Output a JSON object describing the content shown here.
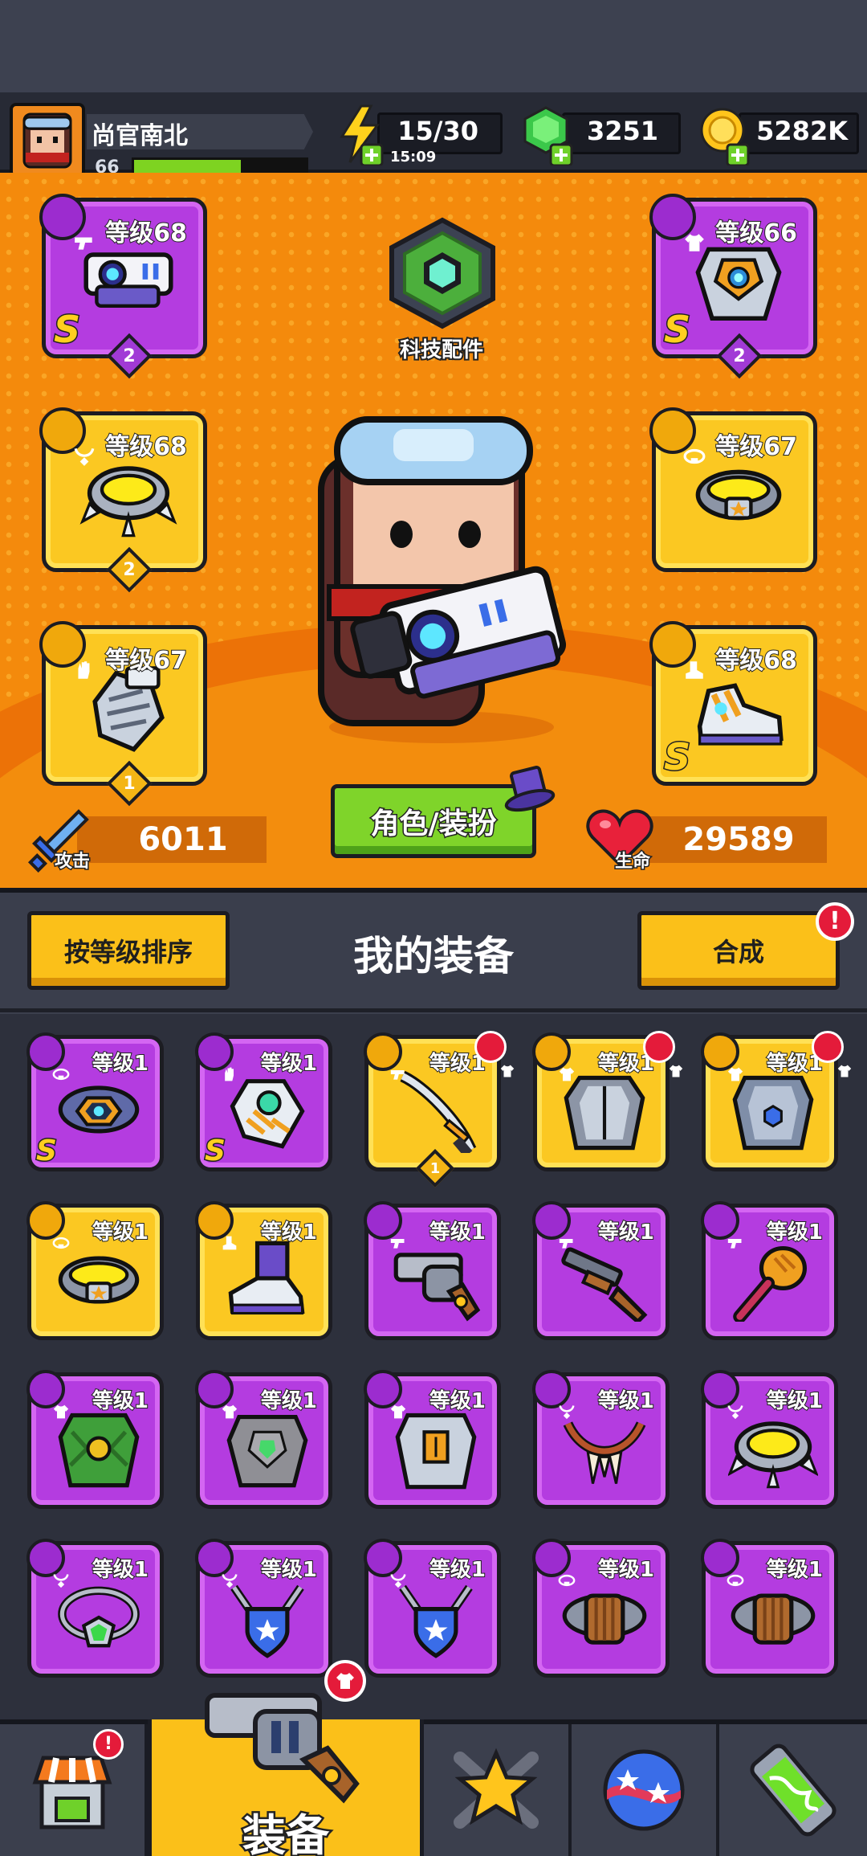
{
  "player": {
    "name": "尚官南北",
    "level": "66",
    "xp_fraction": 0.62
  },
  "resources": {
    "energy": "15/30",
    "energy_timer": "15:09",
    "gems": "3251",
    "coins": "5282K"
  },
  "equipped": {
    "slots": [
      {
        "slot": "weapon",
        "level_label": "等级68",
        "rarity": "purple",
        "rank": "S",
        "stars": "2",
        "icon": "laser-gun-icon",
        "badge_icon": "gun-icon"
      },
      {
        "slot": "armor",
        "level_label": "等级66",
        "rarity": "purple",
        "rank": "S",
        "stars": "2",
        "icon": "mech-armor-icon",
        "badge_icon": "shirt-icon"
      },
      {
        "slot": "necklace",
        "level_label": "等级68",
        "rarity": "gold",
        "rank": "",
        "stars": "2",
        "icon": "spiked-collar-icon",
        "badge_icon": "necklace-icon"
      },
      {
        "slot": "belt",
        "level_label": "等级67",
        "rarity": "gold",
        "rank": "",
        "stars": "",
        "icon": "star-belt-icon",
        "badge_icon": "belt-icon"
      },
      {
        "slot": "gloves",
        "level_label": "等级67",
        "rarity": "gold",
        "rank": "",
        "stars": "1",
        "icon": "gauntlet-icon",
        "badge_icon": "glove-icon"
      },
      {
        "slot": "boots",
        "level_label": "等级68",
        "rarity": "gold",
        "rank": "S",
        "stars": "",
        "icon": "sneaker-icon",
        "badge_icon": "boot-icon"
      }
    ],
    "tech_label": "科技配件",
    "attack_label": "攻击",
    "attack_value": "6011",
    "hp_label": "生命",
    "hp_value": "29589",
    "costume_button": "角色/装扮"
  },
  "gear_section": {
    "sort_button": "按等级排序",
    "title": "我的装备",
    "merge_button": "合成",
    "merge_alert": "!"
  },
  "inventory": [
    {
      "level_label": "等级1",
      "rarity": "purple",
      "rank": "S",
      "icon": "hex-belt-icon",
      "badge_icon": "belt-icon",
      "new": false,
      "stars": ""
    },
    {
      "level_label": "等级1",
      "rarity": "purple",
      "rank": "S",
      "icon": "mech-glove-icon",
      "badge_icon": "glove-icon",
      "new": false,
      "stars": ""
    },
    {
      "level_label": "等级1",
      "rarity": "gold",
      "rank": "",
      "icon": "katana-icon",
      "badge_icon": "gun-icon",
      "new": true,
      "stars": "1"
    },
    {
      "level_label": "等级1",
      "rarity": "gold",
      "rank": "",
      "icon": "chest-plate-icon",
      "badge_icon": "shirt-icon",
      "new": true,
      "stars": ""
    },
    {
      "level_label": "等级1",
      "rarity": "gold",
      "rank": "",
      "icon": "police-armor-icon",
      "badge_icon": "shirt-icon",
      "new": true,
      "stars": ""
    },
    {
      "level_label": "等级1",
      "rarity": "gold",
      "rank": "",
      "icon": "star-belt-icon",
      "badge_icon": "belt-icon",
      "new": false,
      "stars": ""
    },
    {
      "level_label": "等级1",
      "rarity": "gold",
      "rank": "",
      "icon": "purple-boot-icon",
      "badge_icon": "boot-icon",
      "new": false,
      "stars": ""
    },
    {
      "level_label": "等级1",
      "rarity": "purple",
      "rank": "",
      "icon": "revolver-icon",
      "badge_icon": "gun-icon",
      "new": false,
      "stars": ""
    },
    {
      "level_label": "等级1",
      "rarity": "purple",
      "rank": "",
      "icon": "shotgun-icon",
      "badge_icon": "gun-icon",
      "new": false,
      "stars": ""
    },
    {
      "level_label": "等级1",
      "rarity": "purple",
      "rank": "",
      "icon": "torch-icon",
      "badge_icon": "gun-icon",
      "new": false,
      "stars": ""
    },
    {
      "level_label": "等级1",
      "rarity": "purple",
      "rank": "",
      "icon": "leaf-vest-icon",
      "badge_icon": "shirt-icon",
      "new": false,
      "stars": ""
    },
    {
      "level_label": "等级1",
      "rarity": "purple",
      "rank": "",
      "icon": "stone-armor-icon",
      "badge_icon": "shirt-icon",
      "new": false,
      "stars": ""
    },
    {
      "level_label": "等级1",
      "rarity": "purple",
      "rank": "",
      "icon": "plate-armor-icon",
      "badge_icon": "shirt-icon",
      "new": false,
      "stars": ""
    },
    {
      "level_label": "等级1",
      "rarity": "purple",
      "rank": "",
      "icon": "fang-necklace-icon",
      "badge_icon": "necklace-icon",
      "new": false,
      "stars": ""
    },
    {
      "level_label": "等级1",
      "rarity": "purple",
      "rank": "",
      "icon": "spiked-collar-icon",
      "badge_icon": "necklace-icon",
      "new": false,
      "stars": ""
    },
    {
      "level_label": "等级1",
      "rarity": "purple",
      "rank": "",
      "icon": "gem-necklace-icon",
      "badge_icon": "necklace-icon",
      "new": false,
      "stars": ""
    },
    {
      "level_label": "等级1",
      "rarity": "purple",
      "rank": "",
      "icon": "shield-pendant-icon",
      "badge_icon": "necklace-icon",
      "new": false,
      "stars": ""
    },
    {
      "level_label": "等级1",
      "rarity": "purple",
      "rank": "",
      "icon": "shield-pendant-icon",
      "badge_icon": "necklace-icon",
      "new": false,
      "stars": ""
    },
    {
      "level_label": "等级1",
      "rarity": "purple",
      "rank": "",
      "icon": "buckle-belt-icon",
      "badge_icon": "belt-icon",
      "new": false,
      "stars": ""
    },
    {
      "level_label": "等级1",
      "rarity": "purple",
      "rank": "",
      "icon": "buckle-belt-icon",
      "badge_icon": "belt-icon",
      "new": false,
      "stars": ""
    }
  ],
  "nav": {
    "shop_alert": "!",
    "gear_label": "装备",
    "gear_alert_icon": "shirt-icon",
    "tabs": [
      "shop-icon",
      "gear-icon",
      "heroes-icon",
      "planet-icon",
      "lab-icon"
    ]
  },
  "colors": {
    "panel_orange": "#f48a0c",
    "rarity_purple": "#b43ce0",
    "rarity_gold": "#fbc822",
    "button_yellow": "#fbc019",
    "button_green": "#7fd42a",
    "alert_red": "#e41b3a"
  }
}
